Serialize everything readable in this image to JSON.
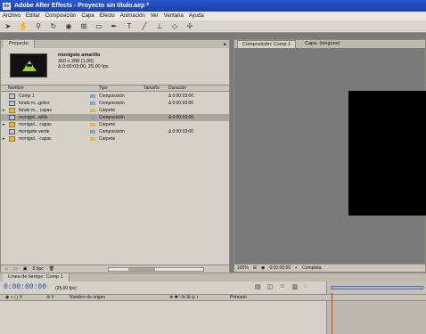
{
  "window": {
    "title": "Adobe After Effects - Proyecto sin título.aep *"
  },
  "menu": [
    "Archivo",
    "Editar",
    "Composición",
    "Capa",
    "Efecto",
    "Animación",
    "Ver",
    "Ventana",
    "Ayuda"
  ],
  "toolbar": {
    "tools": [
      "arrow",
      "hand",
      "zoom",
      "rotate",
      "camera",
      "pan",
      "rectangle",
      "pen",
      "text",
      "brush",
      "clone",
      "eraser",
      "puppet"
    ]
  },
  "project": {
    "tab": "Proyecto",
    "selected": {
      "name": "monigote amarillo",
      "dims": "360 x 288 (1,00)",
      "info": "Δ 0:00:03:00, 25,00 fps"
    },
    "columns": [
      "Nombre",
      "Tipo",
      "Tamaño",
      "Duración"
    ],
    "rows": [
      {
        "name": "Comp 1",
        "type": "Composición",
        "duration": "Δ 0:00:03:00",
        "folder": false,
        "selected": false,
        "label": "#8da0c6"
      },
      {
        "name": "fondo m...gotes",
        "type": "Composición",
        "duration": "Δ 0:00:03:00",
        "folder": false,
        "selected": false,
        "label": "#8da0c6"
      },
      {
        "name": "fondo m... capas",
        "type": "Carpeta",
        "duration": "",
        "folder": true,
        "selected": false,
        "label": "#e3b64a"
      },
      {
        "name": "monigot...arillo",
        "type": "Composición",
        "duration": "Δ 0:00:03:00",
        "folder": false,
        "selected": true,
        "label": "#8da0c6"
      },
      {
        "name": "monigot... capas",
        "type": "Carpeta",
        "duration": "",
        "folder": true,
        "selected": false,
        "label": "#e3b64a"
      },
      {
        "name": "monigote verde",
        "type": "Composición",
        "duration": "Δ 0:00:03:00",
        "folder": false,
        "selected": false,
        "label": "#8da0c6"
      },
      {
        "name": "monigot... capas",
        "type": "Carpeta",
        "duration": "",
        "folder": true,
        "selected": false,
        "label": "#e3b64a"
      }
    ],
    "footer_bpc": "8 bpc"
  },
  "composition": {
    "tab": "Composición: Comp 1",
    "layer_tab": "Capa: (ninguno)",
    "zoom": "100%",
    "time": "0:00:00:00",
    "resolution": "Completa"
  },
  "timeline": {
    "tab": "Línea de tiempo: Comp 1",
    "timecode": "0:00:00:00",
    "fps": "(25,00 fps)",
    "source_header": "Nombre de origen",
    "parent_header": "Primario"
  }
}
